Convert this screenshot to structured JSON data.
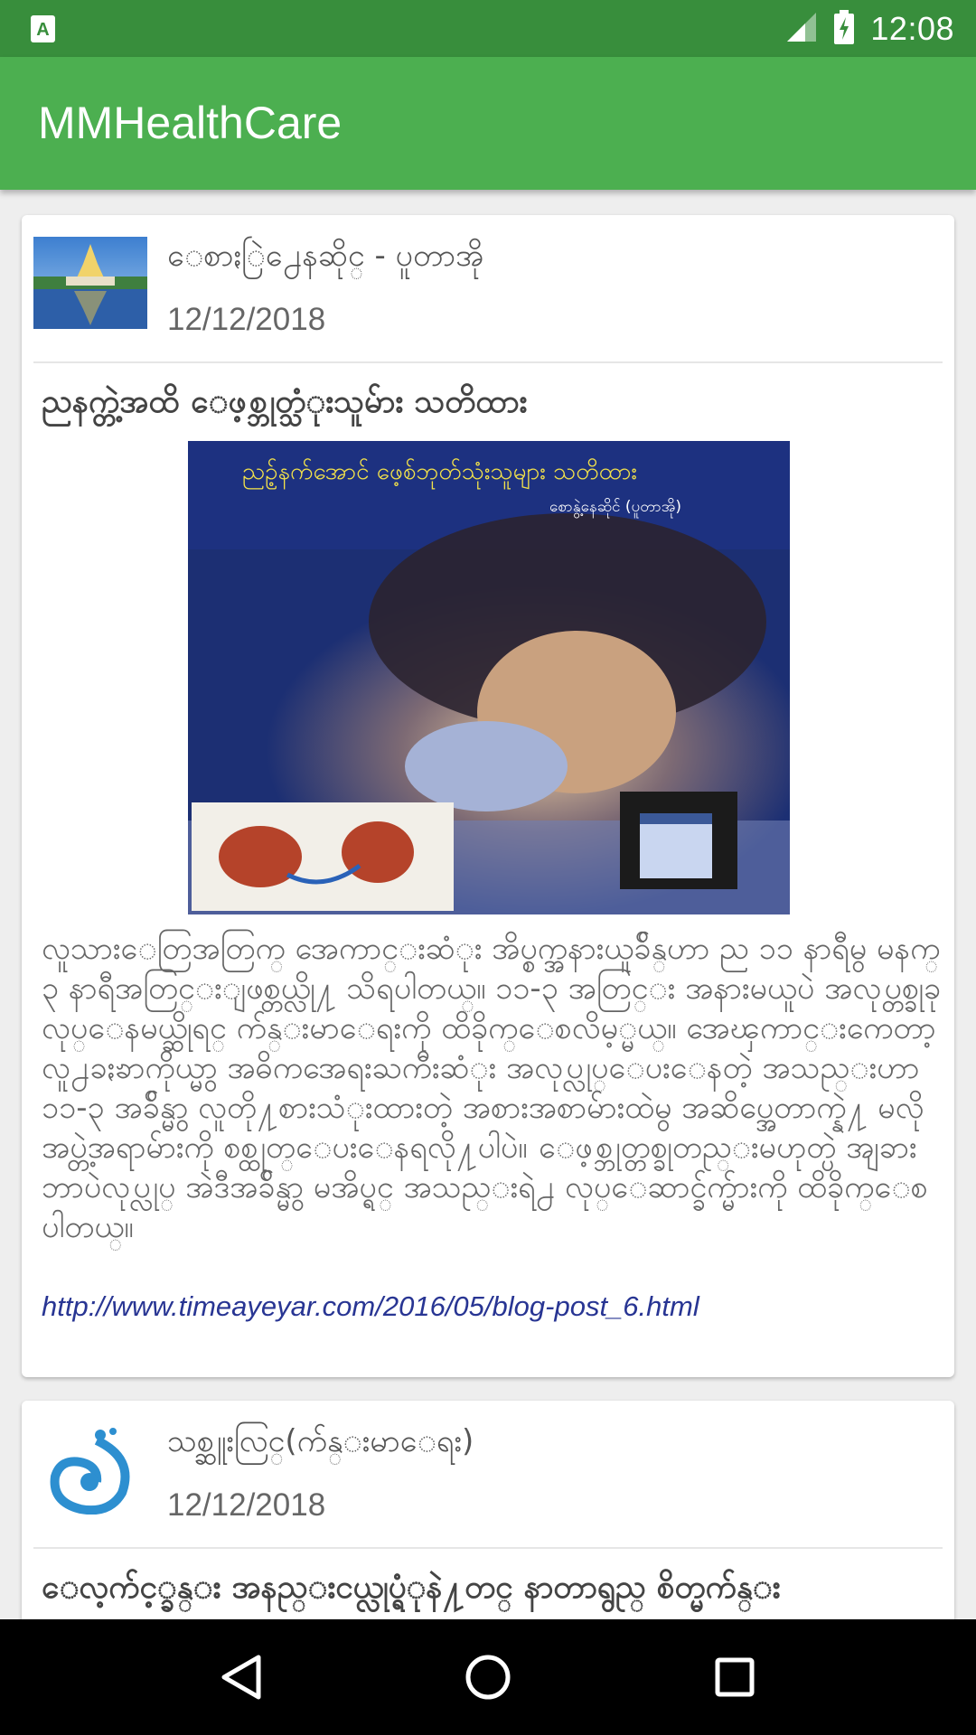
{
  "status_bar": {
    "time": "12:08",
    "left_icon": "a-notification-icon",
    "signal_icon": "cell-signal-icon",
    "battery_icon": "battery-charging-icon"
  },
  "app_bar": {
    "title": "MMHealthCare"
  },
  "posts": [
    {
      "author": "ေစာႏြဲ႕ေနဆိုင္ - ပူတာအို",
      "date": "12/12/2018",
      "title": "ညနက္တဲ့အထိ ေဖ့စ္ဘုတ္သံုးသူမ်ား သတိထား",
      "image_caption_title": "ညဥ့်နက်အောင် ဖေ့စ်ဘုတ်သုံးသူများ သတိထား",
      "image_caption_author": "စောနွဲ့နေဆိုင် (ပူတာအို)",
      "body": "လူသားေတြအတြက္ အေကာင္းဆံုး အိပ္စက္အနားယူခ်ိန္ဟာ ည ၁၁ နာရီမွ မနက္ ၃ နာရီအတြင္းျဖစ္တယ္လို႔ သိရပါတယ္။ ၁၁-၃ အတြင္း အနားမယူပဲ အလုပ္တစ္ခုခု လုပ္ေနမယ္ဆိုရင္ က်န္းမာေရးကို ထိခိုက္ေစလိမ့္မယ္။ အေၾကာင္းကေတာ့ လူ႕ခႏၶာကိုယ္မွာ အဓိကအေရးႀကီးဆံုး အလုပ္လုပ္ေပးေနတဲ့ အသည္းဟာ ၁၁-၃ အခ်ိန္မွာ လူတို႔စားသံုးထားတဲ့ အစားအစာမ်ားထဲမွ အဆိပ္အေတာက္နဲ႔ မလိုအပ္တဲ့အရာမ်ားကို စစ္ထုတ္ေပးေနရလို႔ပါပဲ။ ေဖ့စ္ဘုတ္တစ္ခုတည္းမဟုတ္ပဲ အျခား ဘာပဲလုပ္လုပ္ အဲဒီအခ်ိန္မွာ မအိပ္ရင္ အသည္းရဲ႕ လုပ္ေဆာင္ခ်က္မ်ားကို ထိခိုက္ေစပါတယ္။",
      "link": "http://www.timeayeyar.com/2016/05/blog-post_6.html"
    },
    {
      "author": "သစ္ဆူးလြင္(က်န္းမာေရး)",
      "date": "12/12/2018",
      "title": "ေလ့က်င့္ခန္း အနည္းငယ္လုပ္ရံုနဲ႔တင္ နာတာရွည္ စိတ္မက်န္း"
    }
  ],
  "nav": {
    "back": "back-triangle-icon",
    "home": "home-circle-icon",
    "recents": "recents-square-icon"
  }
}
